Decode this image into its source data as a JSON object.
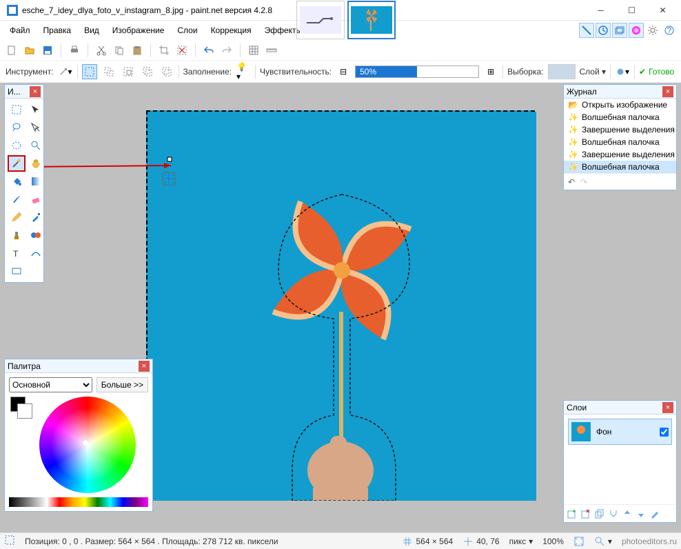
{
  "titlebar": {
    "filename": "esche_7_idey_dlya_foto_v_instagram_8.jpg",
    "appname": "paint.net",
    "version_label": "версия 4.2.8"
  },
  "menu": {
    "file": "Файл",
    "edit": "Правка",
    "view": "Вид",
    "image": "Изображение",
    "layers": "Слои",
    "adjustments": "Коррекция",
    "effects": "Эффекты"
  },
  "tooloptions": {
    "tool_label": "Инструмент:",
    "fill_label": "Заполнение:",
    "tolerance_label": "Чувствительность:",
    "tolerance_value": "50%",
    "sampling_label": "Выборка:",
    "sampling_mode": "Слой",
    "ready_label": "Готово"
  },
  "panels": {
    "tools_title": "И...",
    "history_title": "Журнал",
    "layers_title": "Слои",
    "palette_title": "Палитра"
  },
  "history": {
    "items": [
      "Открыть изображение",
      "Волшебная палочка",
      "Завершение выделения палочкой",
      "Волшебная палочка",
      "Завершение выделения палочкой",
      "Волшебная палочка"
    ],
    "active_index": 5
  },
  "layers": {
    "items": [
      {
        "name": "Фон",
        "visible": true
      }
    ]
  },
  "palette": {
    "mode": "Основной",
    "more_label": "Больше >>",
    "primary_color": "#000000",
    "secondary_color": "#ffffff"
  },
  "status": {
    "position_size": "Позиция: 0 , 0 . Размер: 564  × 564 . Площадь: 278 712 кв. пиксели",
    "dims": "564 × 564",
    "cursor": "40, 76",
    "units": "пикс",
    "zoom": "100%",
    "credit": "photoeditors.ru"
  },
  "colors": {
    "accent": "#1976d2",
    "canvas_blue": "#129dce"
  }
}
